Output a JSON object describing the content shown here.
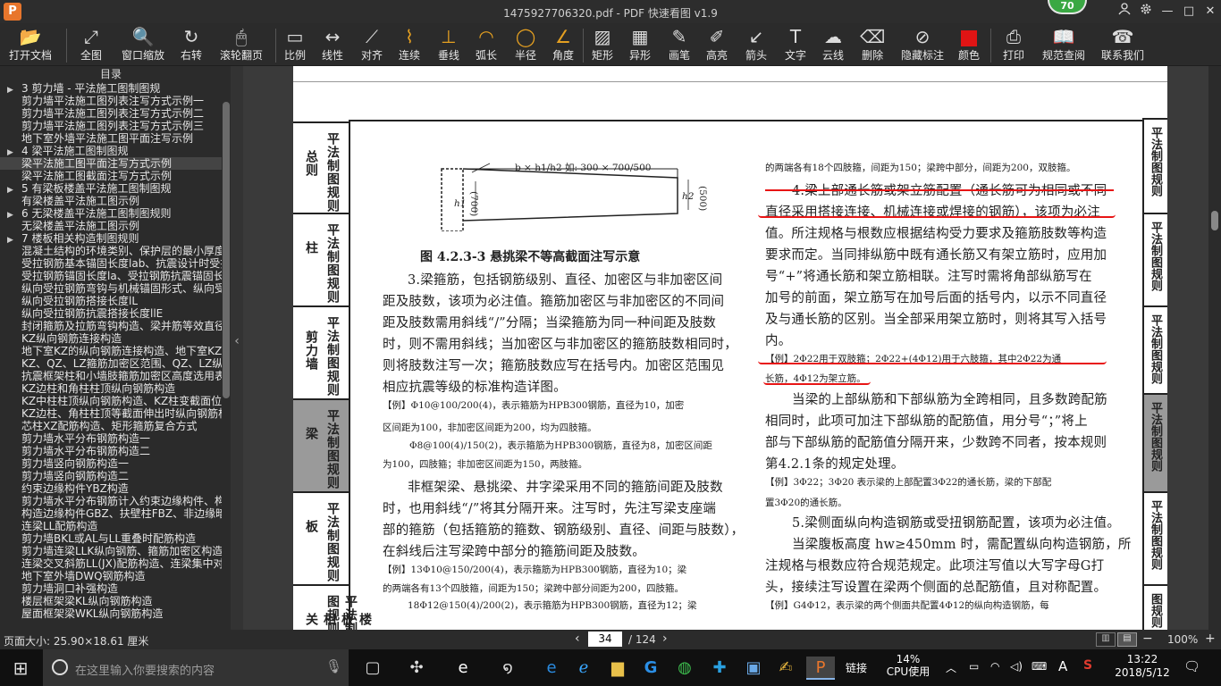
{
  "window": {
    "title": "1475927706320.pdf - PDF 快速看图 v1.9",
    "app_logo": "P",
    "score": "70"
  },
  "window_controls": {
    "user": "person-icon",
    "settings": "gear-icon",
    "minimize": "—",
    "maximize": "□",
    "close": "✕"
  },
  "toolbar": {
    "items": [
      {
        "label": "打开文档",
        "icon": "📂"
      },
      {
        "label": "全图",
        "icon": "⤢"
      },
      {
        "label": "窗口缩放",
        "icon": "🔍"
      },
      {
        "label": "右转",
        "icon": "↻"
      },
      {
        "label": "滚轮翻页",
        "icon": "🖱"
      },
      {
        "label": "比例",
        "icon": "▭"
      },
      {
        "label": "线性",
        "icon": "↔"
      },
      {
        "label": "对齐",
        "icon": "⟋"
      },
      {
        "label": "连续",
        "icon": "⌇"
      },
      {
        "label": "垂线",
        "icon": "⊥"
      },
      {
        "label": "弧长",
        "icon": "◠"
      },
      {
        "label": "半径",
        "icon": "◯"
      },
      {
        "label": "角度",
        "icon": "∠"
      },
      {
        "label": "矩形",
        "icon": "▨"
      },
      {
        "label": "异形",
        "icon": "▦"
      },
      {
        "label": "画笔",
        "icon": "✎"
      },
      {
        "label": "高亮",
        "icon": "✐"
      },
      {
        "label": "箭头",
        "icon": "↙"
      },
      {
        "label": "文字",
        "icon": "T"
      },
      {
        "label": "云线",
        "icon": "☁"
      },
      {
        "label": "删除",
        "icon": "⌫"
      },
      {
        "label": "隐藏标注",
        "icon": "⊘"
      },
      {
        "label": "颜色",
        "icon": ""
      },
      {
        "label": "打印",
        "icon": "⎙"
      },
      {
        "label": "规范查阅",
        "icon": "📖"
      },
      {
        "label": "联系我们",
        "icon": "☎"
      }
    ]
  },
  "toc": {
    "title": "目录",
    "items": [
      {
        "text": "3 剪力墙 - 平法施工图制图规",
        "level": 1
      },
      {
        "text": "剪力墙平法施工图列表注写方式示例一",
        "level": 2
      },
      {
        "text": "剪力墙平法施工图列表注写方式示例二",
        "level": 2
      },
      {
        "text": "剪力墙平法施工图列表注写方式示例三",
        "level": 2
      },
      {
        "text": "地下室外墙平法施工图平面注写示例",
        "level": 2
      },
      {
        "text": "4 梁平法施工图制图规",
        "level": 1
      },
      {
        "text": "梁平法施工图平面注写方式示例",
        "level": 2,
        "selected": true
      },
      {
        "text": "梁平法施工图截面注写方式示例",
        "level": 2
      },
      {
        "text": "5 有梁板楼盖平法施工图制图规",
        "level": 1
      },
      {
        "text": "有梁楼盖平法施工图示例",
        "level": 2
      },
      {
        "text": "6 无梁楼盖平法施工图制图规则",
        "level": 1
      },
      {
        "text": "无梁楼盖平法施工图示例",
        "level": 2
      },
      {
        "text": "7 楼板相关构造制图规则",
        "level": 1
      },
      {
        "text": "混凝土结构的环境类别、保护层的最小厚度",
        "level": 2
      },
      {
        "text": "受拉钢筋基本锚固长度lab、抗震设计时受拉",
        "level": 2
      },
      {
        "text": "受拉钢筋锚固长度la、受拉钢筋抗震锚固长",
        "level": 2
      },
      {
        "text": "纵向受拉钢筋弯钩与机械锚固形式、纵向受力钢",
        "level": 2
      },
      {
        "text": "纵向受拉钢筋搭接长度lL",
        "level": 2
      },
      {
        "text": "纵向受拉钢筋抗震搭接长度llE",
        "level": 2
      },
      {
        "text": "封闭箍筋及拉筋弯钩构造、梁并筋等效直径",
        "level": 2
      },
      {
        "text": "KZ纵向钢筋连接构造",
        "level": 2
      },
      {
        "text": "地下室KZ的纵向钢筋连接构造、地下室KZ的",
        "level": 2
      },
      {
        "text": "KZ、QZ、LZ箍筋加密区范围、QZ、LZ纵向钢",
        "level": 2
      },
      {
        "text": "抗震框架柱和小墙肢箍筋加密区高度选用表",
        "level": 2
      },
      {
        "text": "KZ边柱和角柱柱顶纵向钢筋构造",
        "level": 2
      },
      {
        "text": "KZ中柱柱顶纵向钢筋构造、KZ柱变截面位置",
        "level": 2
      },
      {
        "text": "KZ边柱、角柱柱顶等截面伸出时纵向钢筋构",
        "level": 2
      },
      {
        "text": "芯柱XZ配筋构造、矩形箍筋复合方式",
        "level": 2
      },
      {
        "text": "剪力墙水平分布钢筋构造一",
        "level": 2
      },
      {
        "text": "剪力墙水平分布钢筋构造二",
        "level": 2
      },
      {
        "text": "剪力墙竖向钢筋构造一",
        "level": 2
      },
      {
        "text": "剪力墙竖向钢筋构造二",
        "level": 2
      },
      {
        "text": "约束边缘构件YBZ构造",
        "level": 2
      },
      {
        "text": "剪力墙水平分布钢筋计入约束边缘构件、构",
        "level": 2
      },
      {
        "text": "构造边缘构件GBZ、扶壁柱FBZ、非边缘暗柱",
        "level": 2
      },
      {
        "text": "连梁LL配筋构造",
        "level": 2
      },
      {
        "text": "剪力墙BKL或AL与LL重叠时配筋构造",
        "level": 2
      },
      {
        "text": "剪力墙连梁LLK纵向钢筋、箍筋加密区构造",
        "level": 2
      },
      {
        "text": "连梁交叉斜筋LL(JX)配筋构造、连梁集中对",
        "level": 2
      },
      {
        "text": "地下室外墙DWQ钢筋构造",
        "level": 2
      },
      {
        "text": "剪力墙洞口补强构造",
        "level": 2
      },
      {
        "text": "楼层框架梁KL纵向钢筋构造",
        "level": 2
      },
      {
        "text": "屋面框架梁WKL纵向钢筋构造",
        "level": 2
      }
    ]
  },
  "page": {
    "left_tabs": [
      {
        "a": "总则",
        "b": "平法制图规则"
      },
      {
        "a": "柱",
        "b": "平法制图规则"
      },
      {
        "a": "剪力墙",
        "b": "平法制图规则"
      },
      {
        "a": "梁",
        "b": "平法制图规则",
        "active": true
      },
      {
        "a": "板",
        "b": "平法制图规则"
      },
      {
        "a": "楼板相关",
        "b": "平法制图规则"
      }
    ],
    "right_tabs": [
      {
        "t": "平法制图规则"
      },
      {
        "t": "平法制图规则"
      },
      {
        "t": "平法制图规则"
      },
      {
        "t": "平法制图规则",
        "active": true
      },
      {
        "t": "平法制图规则"
      },
      {
        "t": "平法制图规则"
      }
    ],
    "figure": {
      "dim_label": "b × h1/h2 如: 300 × 700/500",
      "h1": "h1",
      "v700": "(700)",
      "h2": "h2",
      "v500": "(500)",
      "caption": "图 4.2.3-3 悬挑梁不等高截面注写示意"
    },
    "left_col": [
      "3.梁箍筋，包括钢筋级别、直径、加密区与非加密区间",
      "距及肢数，该项为必注值。箍筋加密区与非加密区的不同间",
      "距及肢数需用斜线“/”分隔；当梁箍筋为同一种间距及肢数",
      "时，则不需用斜线；当加密区与非加密区的箍筋肢数相同时，",
      "则将肢数注写一次；箍筋肢数应写在括号内。加密区范围见",
      "相应抗震等级的标准构造详图。",
      "【例】Φ10@100/200(4)，表示箍筋为HPB300钢筋，直径为10，加密",
      "区间距为100，非加密区间距为200，均为四肢箍。",
      "Φ8@100(4)/150(2)，表示箍筋为HPB300钢筋，直径为8，加密区间距",
      "为100，四肢箍；非加密区间距为150，两肢箍。",
      "非框架梁、悬挑梁、井字梁采用不同的箍筋间距及肢数",
      "时，也用斜线“/”将其分隔开来。注写时，先注写梁支座端",
      "部的箍筋（包括箍筋的箍数、钢筋级别、直径、间距与肢数），",
      "在斜线后注写梁跨中部分的箍筋间距及肢数。",
      "【例】13Φ10@150/200(4)，表示箍筋为HPB300钢筋，直径为10；梁",
      "的两端各有13个四肢箍，间距为150；梁跨中部分间距为200，四肢箍。",
      "18Φ12@150(4)/200(2)，表示箍筋为HPB300钢筋，直径为12；梁"
    ],
    "right_col": [
      "的两端各有18个四肢箍，间距为150；梁跨中部分，间距为200，双肢箍。",
      "4.梁上部通长筋或架立筋配置（通长筋可为相同或不同",
      "直径采用搭接连接、机械连接或焊接的钢筋），该项为必注",
      "值。所注规格与根数应根据结构受力要求及箍筋肢数等构造",
      "要求而定。当同排纵筋中既有通长筋又有架立筋时，应用加",
      "号“+”将通长筋和架立筋相联。注写时需将角部纵筋写在",
      "加号的前面，架立筋写在加号后面的括号内，以示不同直径",
      "及与通长筋的区别。当全部采用架立筋时，则将其写入括号",
      "内。",
      "【例】2Φ22用于双肢箍；2Φ22+(4Φ12)用于六肢箍，其中2Φ22为通",
      "长筋，4Φ12为架立筋。",
      "当梁的上部纵筋和下部纵筋为全跨相同，且多数跨配筋",
      "相同时，此项可加注下部纵筋的配筋值，用分号“；”将上",
      "部与下部纵筋的配筋值分隔开来，少数跨不同者，按本规则",
      "第4.2.1条的规定处理。",
      "【例】3Φ22；3Φ20 表示梁的上部配置3Φ22的通长筋，梁的下部配",
      "置3Φ20的通长筋。",
      "5.梁侧面纵向构造钢筋或受扭钢筋配置，该项为必注值。",
      "当梁腹板高度 hw≥450mm 时，需配置纵向构造钢筋，所",
      "注规格与根数应符合规范规定。此项注写值以大写字母G打",
      "头，接续注写设置在梁两个侧面的总配筋值，且对称配置。",
      "【例】G4Φ12，表示梁的两个侧面共配置4Φ12的纵向构造钢筋，每"
    ]
  },
  "status": {
    "page_size": "页面大小: 25.90×18.61 厘米",
    "page_current": "34",
    "page_total": "/ 124",
    "zoom": "100%",
    "prev": "‹",
    "next": "›",
    "zoom_out": "−",
    "zoom_in": "+"
  },
  "taskbar": {
    "search_placeholder": "在这里输入你要搜索的内容",
    "link": "链接",
    "cpu_pct": "14%",
    "cpu_label": "CPU使用",
    "lang": "A",
    "time": "13:22",
    "date": "2018/5/12"
  }
}
